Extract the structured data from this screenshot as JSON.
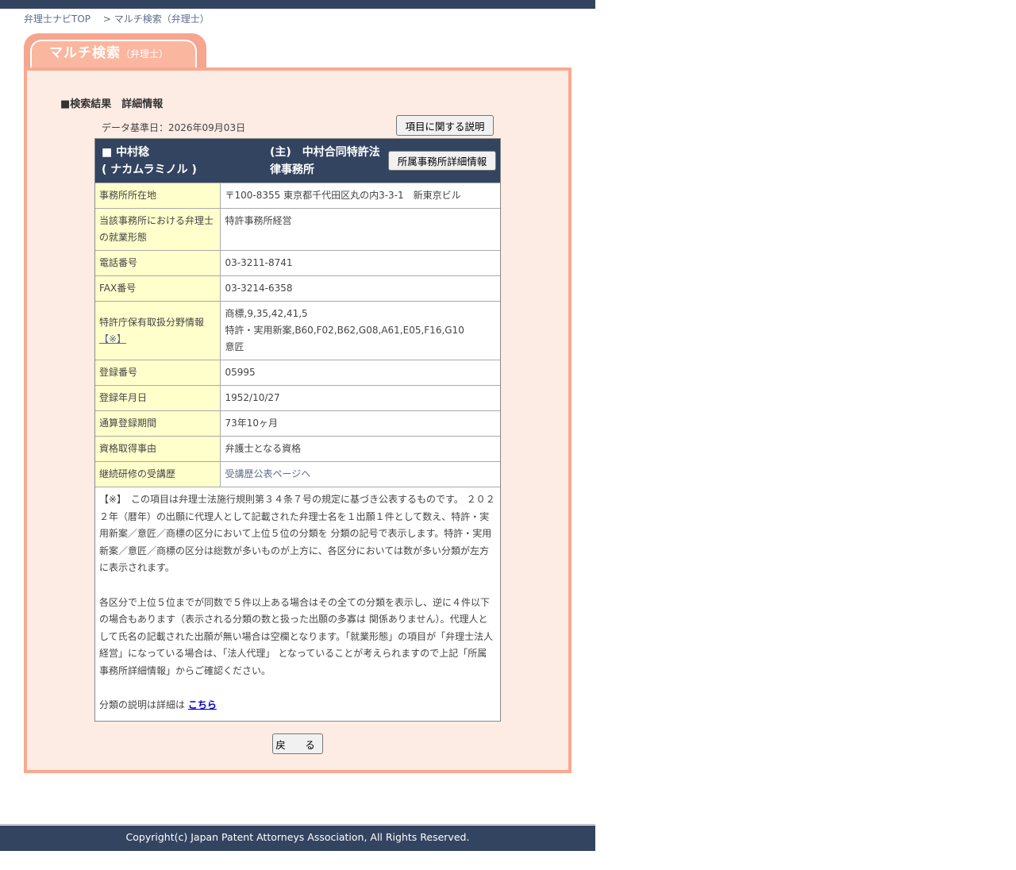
{
  "breadcrumb": {
    "top": "弁理士ナビTOP",
    "current": "> マルチ検索（弁理士）"
  },
  "tab": {
    "title": "マルチ検索",
    "sub": "（弁理士）"
  },
  "heading": "■検索結果　詳細情報",
  "base_date": "データ基準日：2026年09月03日",
  "explain_button": "項目に関する説明",
  "attorney": {
    "name_line1": "■ 中村稔",
    "name_line2": "( ナカムラミノル )",
    "office_line1": "(主)　中村合同特許法",
    "office_line2": "律事務所",
    "office_button": "所属事務所詳細情報"
  },
  "rows": {
    "address": {
      "label": "事務所所在地",
      "value": "〒100-8355 東京都千代田区丸の内3-3-1　新東京ビル"
    },
    "employment": {
      "label": "当該事務所における弁理士の就業形態",
      "value": "特許事務所経営"
    },
    "phone": {
      "label": "電話番号",
      "value": "03-3211-8741"
    },
    "fax": {
      "label": "FAX番号",
      "value": "03-3214-6358"
    },
    "fields": {
      "label": "特許庁保有取扱分野情報",
      "note_link": "【※】",
      "value1": "商標,9,35,42,41,5",
      "value2": "特許・実用新案,B60,F02,B62,G08,A61,E05,F16,G10",
      "value3": "意匠"
    },
    "reg_no": {
      "label": "登録番号",
      "value": "05995"
    },
    "reg_date": {
      "label": "登録年月日",
      "value": "1952/10/27"
    },
    "period": {
      "label": "通算登録期間",
      "value": "73年10ヶ月"
    },
    "qualification": {
      "label": "資格取得事由",
      "value": "弁護士となる資格"
    },
    "training": {
      "label": "継続研修の受講歴",
      "value": "受講歴公表ページへ"
    }
  },
  "notes": {
    "p1": "【※】　この項目は弁理士法施行規則第３４条７号の規定に基づき公表するものです。 ２０２２年（暦年）の出願に代理人として記載された弁理士名を１出願１件として数え、特許・実用新案／意匠／商標の区分において上位５位の分類を 分類の記号で表示します。特許・実用新案／意匠／商標の区分は総数が多いものが上方に、各区分においては数が多い分類が左方に表示されます。",
    "p2": "各区分で上位５位までが同数で５件以上ある場合はその全ての分類を表示し、逆に４件以下の場合もあります（表示される分類の数と扱った出願の多寡は 関係ありません）。代理人として氏名の記載された出願が無い場合は空欄となります。「就業形態」の項目が「弁理士法人経営」になっている場合は、「法人代理」 となっていることが考えられますので上記「所属事務所詳細情報」からご確認ください。",
    "p3_prefix": "分類の説明は詳細は ",
    "p3_link": "こちら"
  },
  "back_button": "戻　る",
  "footer": "Copyright(c) Japan Patent Attorneys Association, All Rights Reserved."
}
